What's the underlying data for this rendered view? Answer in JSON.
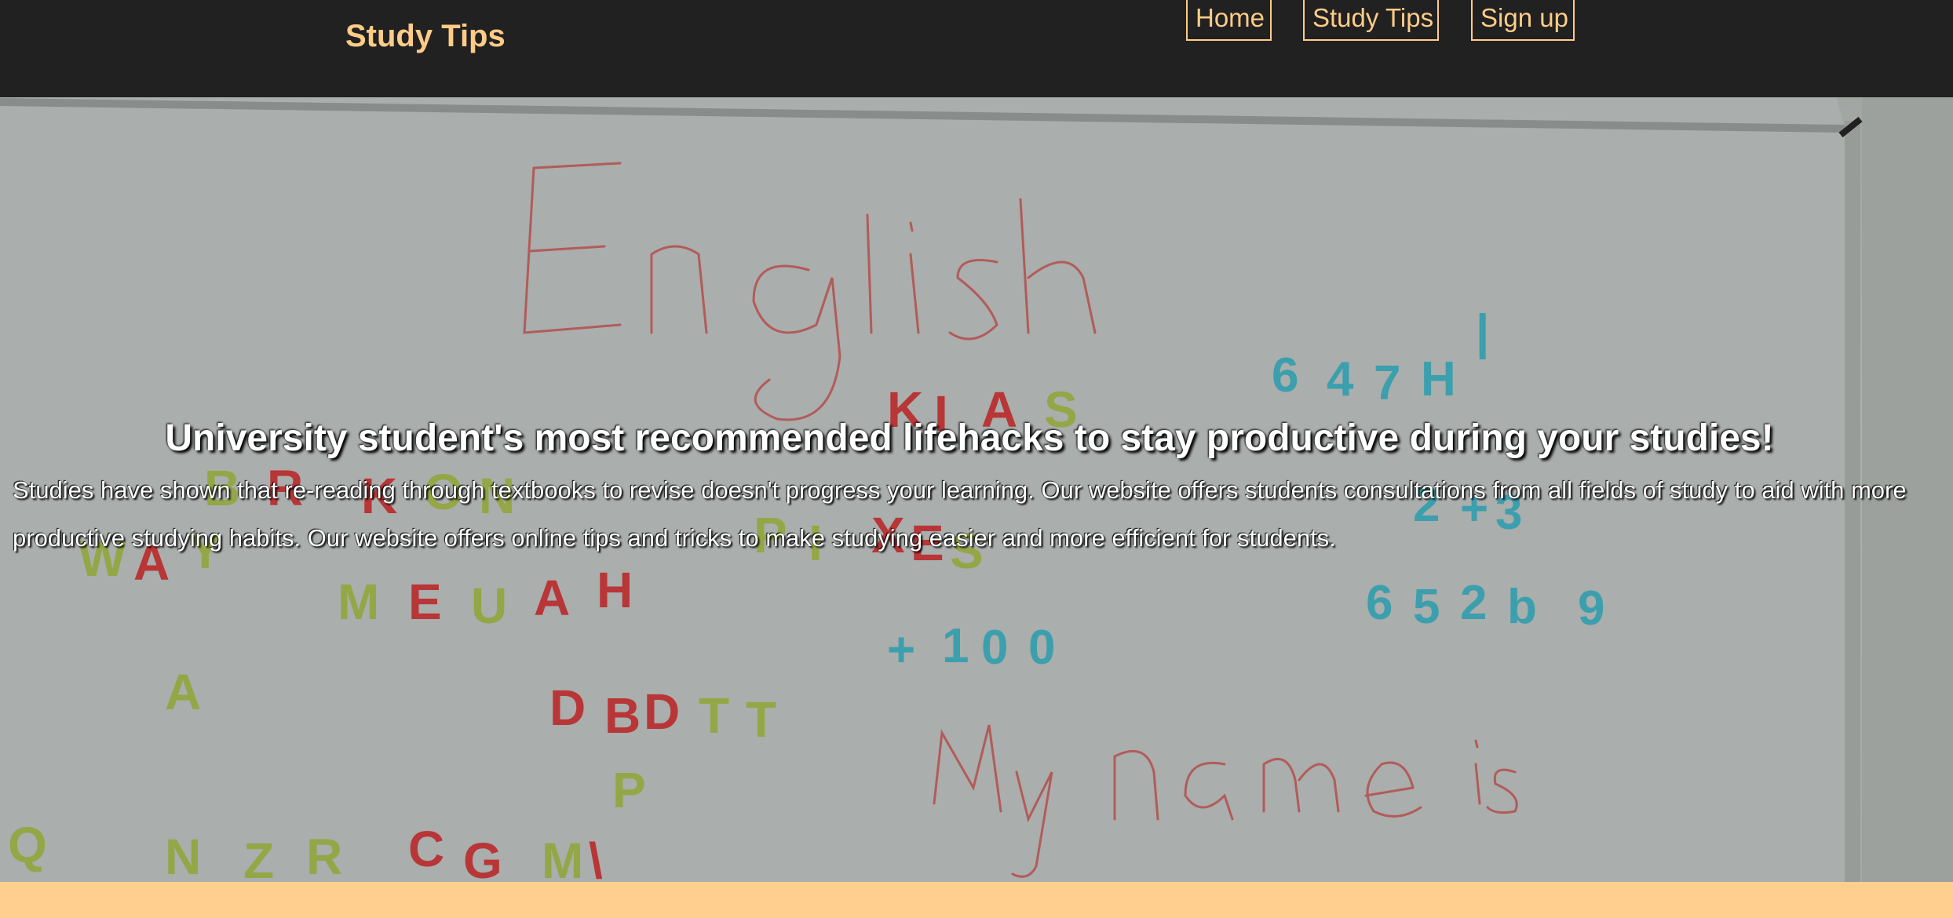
{
  "header": {
    "brand": "Study Tips",
    "nav": [
      {
        "label": "Home"
      },
      {
        "label": "Study Tips"
      },
      {
        "label": "Sign up"
      }
    ]
  },
  "hero": {
    "title": "University student's most recommended lifehacks to stay productive during your studies!",
    "body": "Studies have shown that re-reading through textbooks to revise doesn't progress your learning. Our website offers students consultations from all fields of study to aid with more productive studying habits. Our website offers online tips and tricks to make studying easier and more efficient for students."
  },
  "colors": {
    "header_bg": "#212121",
    "accent": "#ffcc88",
    "footer_band": "#ffcf8f"
  }
}
